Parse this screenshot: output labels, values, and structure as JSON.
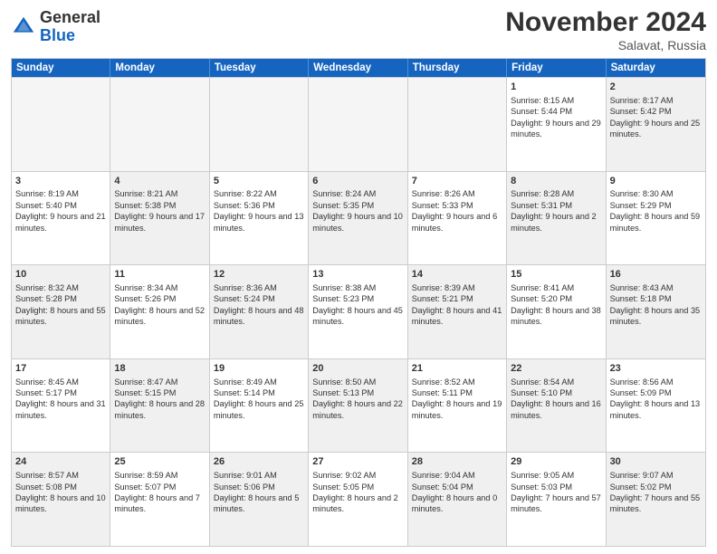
{
  "header": {
    "logo_line1": "General",
    "logo_line2": "Blue",
    "month": "November 2024",
    "location": "Salavat, Russia"
  },
  "weekdays": [
    "Sunday",
    "Monday",
    "Tuesday",
    "Wednesday",
    "Thursday",
    "Friday",
    "Saturday"
  ],
  "rows": [
    [
      {
        "day": "",
        "text": "",
        "empty": true
      },
      {
        "day": "",
        "text": "",
        "empty": true
      },
      {
        "day": "",
        "text": "",
        "empty": true
      },
      {
        "day": "",
        "text": "",
        "empty": true
      },
      {
        "day": "",
        "text": "",
        "empty": true
      },
      {
        "day": "1",
        "text": "Sunrise: 8:15 AM\nSunset: 5:44 PM\nDaylight: 9 hours and 29 minutes."
      },
      {
        "day": "2",
        "text": "Sunrise: 8:17 AM\nSunset: 5:42 PM\nDaylight: 9 hours and 25 minutes.",
        "shaded": true
      }
    ],
    [
      {
        "day": "3",
        "text": "Sunrise: 8:19 AM\nSunset: 5:40 PM\nDaylight: 9 hours and 21 minutes."
      },
      {
        "day": "4",
        "text": "Sunrise: 8:21 AM\nSunset: 5:38 PM\nDaylight: 9 hours and 17 minutes.",
        "shaded": true
      },
      {
        "day": "5",
        "text": "Sunrise: 8:22 AM\nSunset: 5:36 PM\nDaylight: 9 hours and 13 minutes."
      },
      {
        "day": "6",
        "text": "Sunrise: 8:24 AM\nSunset: 5:35 PM\nDaylight: 9 hours and 10 minutes.",
        "shaded": true
      },
      {
        "day": "7",
        "text": "Sunrise: 8:26 AM\nSunset: 5:33 PM\nDaylight: 9 hours and 6 minutes."
      },
      {
        "day": "8",
        "text": "Sunrise: 8:28 AM\nSunset: 5:31 PM\nDaylight: 9 hours and 2 minutes.",
        "shaded": true
      },
      {
        "day": "9",
        "text": "Sunrise: 8:30 AM\nSunset: 5:29 PM\nDaylight: 8 hours and 59 minutes."
      }
    ],
    [
      {
        "day": "10",
        "text": "Sunrise: 8:32 AM\nSunset: 5:28 PM\nDaylight: 8 hours and 55 minutes.",
        "shaded": true
      },
      {
        "day": "11",
        "text": "Sunrise: 8:34 AM\nSunset: 5:26 PM\nDaylight: 8 hours and 52 minutes."
      },
      {
        "day": "12",
        "text": "Sunrise: 8:36 AM\nSunset: 5:24 PM\nDaylight: 8 hours and 48 minutes.",
        "shaded": true
      },
      {
        "day": "13",
        "text": "Sunrise: 8:38 AM\nSunset: 5:23 PM\nDaylight: 8 hours and 45 minutes."
      },
      {
        "day": "14",
        "text": "Sunrise: 8:39 AM\nSunset: 5:21 PM\nDaylight: 8 hours and 41 minutes.",
        "shaded": true
      },
      {
        "day": "15",
        "text": "Sunrise: 8:41 AM\nSunset: 5:20 PM\nDaylight: 8 hours and 38 minutes."
      },
      {
        "day": "16",
        "text": "Sunrise: 8:43 AM\nSunset: 5:18 PM\nDaylight: 8 hours and 35 minutes.",
        "shaded": true
      }
    ],
    [
      {
        "day": "17",
        "text": "Sunrise: 8:45 AM\nSunset: 5:17 PM\nDaylight: 8 hours and 31 minutes."
      },
      {
        "day": "18",
        "text": "Sunrise: 8:47 AM\nSunset: 5:15 PM\nDaylight: 8 hours and 28 minutes.",
        "shaded": true
      },
      {
        "day": "19",
        "text": "Sunrise: 8:49 AM\nSunset: 5:14 PM\nDaylight: 8 hours and 25 minutes."
      },
      {
        "day": "20",
        "text": "Sunrise: 8:50 AM\nSunset: 5:13 PM\nDaylight: 8 hours and 22 minutes.",
        "shaded": true
      },
      {
        "day": "21",
        "text": "Sunrise: 8:52 AM\nSunset: 5:11 PM\nDaylight: 8 hours and 19 minutes."
      },
      {
        "day": "22",
        "text": "Sunrise: 8:54 AM\nSunset: 5:10 PM\nDaylight: 8 hours and 16 minutes.",
        "shaded": true
      },
      {
        "day": "23",
        "text": "Sunrise: 8:56 AM\nSunset: 5:09 PM\nDaylight: 8 hours and 13 minutes."
      }
    ],
    [
      {
        "day": "24",
        "text": "Sunrise: 8:57 AM\nSunset: 5:08 PM\nDaylight: 8 hours and 10 minutes.",
        "shaded": true
      },
      {
        "day": "25",
        "text": "Sunrise: 8:59 AM\nSunset: 5:07 PM\nDaylight: 8 hours and 7 minutes."
      },
      {
        "day": "26",
        "text": "Sunrise: 9:01 AM\nSunset: 5:06 PM\nDaylight: 8 hours and 5 minutes.",
        "shaded": true
      },
      {
        "day": "27",
        "text": "Sunrise: 9:02 AM\nSunset: 5:05 PM\nDaylight: 8 hours and 2 minutes."
      },
      {
        "day": "28",
        "text": "Sunrise: 9:04 AM\nSunset: 5:04 PM\nDaylight: 8 hours and 0 minutes.",
        "shaded": true
      },
      {
        "day": "29",
        "text": "Sunrise: 9:05 AM\nSunset: 5:03 PM\nDaylight: 7 hours and 57 minutes."
      },
      {
        "day": "30",
        "text": "Sunrise: 9:07 AM\nSunset: 5:02 PM\nDaylight: 7 hours and 55 minutes.",
        "shaded": true
      }
    ]
  ]
}
